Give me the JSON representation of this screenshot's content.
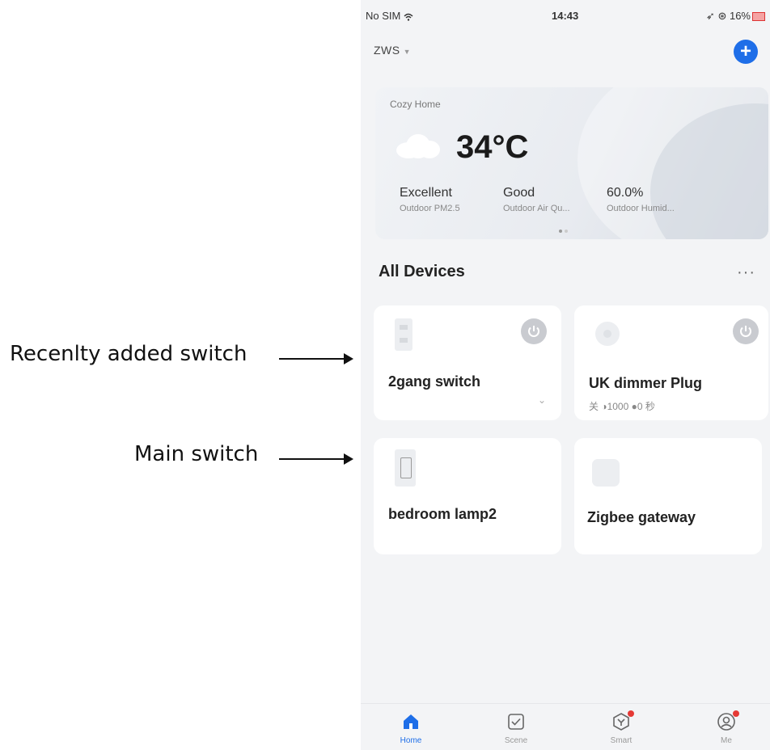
{
  "annotations": [
    {
      "text": "Recenlty added switch"
    },
    {
      "text": "Main switch"
    }
  ],
  "status_bar": {
    "carrier": "No SIM",
    "time": "14:43",
    "battery": "16%"
  },
  "header": {
    "home_name": "ZWS",
    "add_label": "+"
  },
  "weather": {
    "location": "Cozy Home",
    "temperature": "34°C",
    "metrics": [
      {
        "value": "Excellent",
        "label": "Outdoor PM2.5"
      },
      {
        "value": "Good",
        "label": "Outdoor Air Qu..."
      },
      {
        "value": "60.0%",
        "label": "Outdoor Humid..."
      }
    ]
  },
  "devices_section": {
    "title": "All Devices",
    "more": "···"
  },
  "devices": [
    {
      "name": "2gang switch",
      "icon": "wall-switch-icon",
      "has_power": true
    },
    {
      "name": "UK dimmer Plug",
      "icon": "plug-icon",
      "has_power": true,
      "status": "关 ◑1000 ●0 秒"
    },
    {
      "name": "bedroom lamp2",
      "icon": "wall-switch-icon",
      "has_power": false
    },
    {
      "name": "Zigbee gateway",
      "icon": "gateway-icon",
      "has_power": false
    }
  ],
  "tabs": [
    {
      "label": "Home",
      "active": true
    },
    {
      "label": "Scene",
      "active": false
    },
    {
      "label": "Smart",
      "active": false
    },
    {
      "label": "Me",
      "active": false
    }
  ],
  "colors": {
    "accent": "#1e6ee8",
    "background": "#f3f4f6",
    "notification": "#e53935"
  }
}
